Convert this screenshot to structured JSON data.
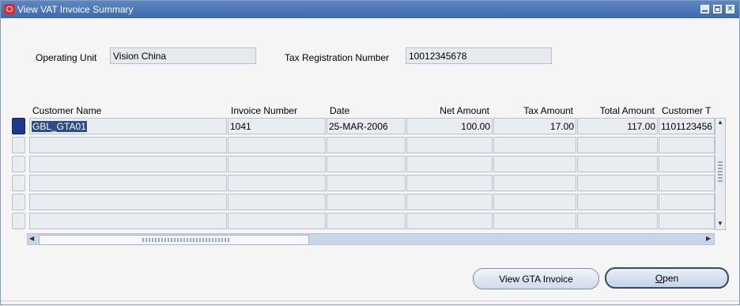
{
  "window": {
    "title": "View VAT Invoice Summary"
  },
  "header": {
    "operating_unit_label": "Operating Unit",
    "operating_unit_value": "Vision China",
    "tax_reg_label": "Tax Registration Number",
    "tax_reg_value": "10012345678"
  },
  "table": {
    "columns": [
      "Customer Name",
      "Invoice Number",
      "Date",
      "Net Amount",
      "Tax Amount",
      "Total Amount",
      "Customer T"
    ],
    "rows": [
      {
        "customer_name": "GBL_GTA01",
        "invoice_number": "1041",
        "date": "25-MAR-2006",
        "net_amount": "100.00",
        "tax_amount": "17.00",
        "total_amount": "117.00",
        "customer_t": "1101123456"
      }
    ]
  },
  "buttons": {
    "view_gta": "View GTA Invoice",
    "open_prefix": "",
    "open_mnemonic": "O",
    "open_rest": "pen"
  },
  "colors": {
    "titlebar": "#3d69ad",
    "selection": "#2d4b8a"
  }
}
